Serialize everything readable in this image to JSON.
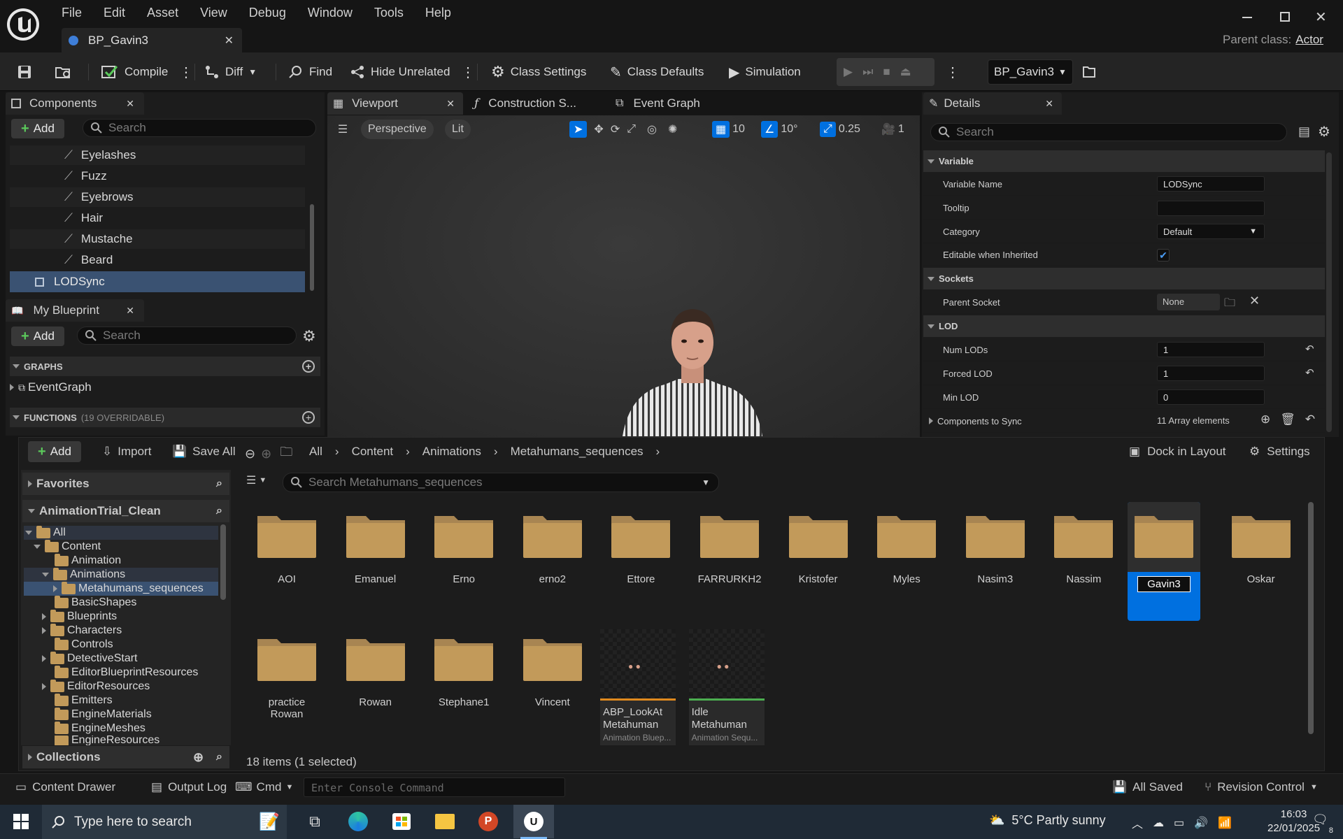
{
  "menu": [
    "File",
    "Edit",
    "Asset",
    "View",
    "Debug",
    "Window",
    "Tools",
    "Help"
  ],
  "doc_tab": {
    "title": "BP_Gavin3"
  },
  "parent_class": {
    "label": "Parent class:",
    "value": "Actor"
  },
  "toolbar": {
    "compile": "Compile",
    "diff": "Diff",
    "find": "Find",
    "hide_unrelated": "Hide Unrelated",
    "class_settings": "Class Settings",
    "class_defaults": "Class Defaults",
    "simulation": "Simulation",
    "debug_object": "BP_Gavin3"
  },
  "components": {
    "tab": "Components",
    "add": "Add",
    "search_placeholder": "Search",
    "items": [
      "Eyelashes",
      "Fuzz",
      "Eyebrows",
      "Hair",
      "Mustache",
      "Beard"
    ],
    "selected": "LODSync"
  },
  "my_blueprint": {
    "tab": "My Blueprint",
    "add": "Add",
    "search_placeholder": "Search",
    "graphs_header": "GRAPHS",
    "event_graph": "EventGraph",
    "functions_header": "FUNCTIONS",
    "functions_count": "(19 OVERRIDABLE)"
  },
  "center_tabs": {
    "viewport": "Viewport",
    "construction": "Construction S...",
    "event_graph": "Event Graph"
  },
  "viewport": {
    "perspective": "Perspective",
    "lit": "Lit",
    "grid": "10",
    "angle": "10°",
    "scale": "0.25",
    "camera": "1"
  },
  "details": {
    "tab": "Details",
    "search_placeholder": "Search",
    "variable_header": "Variable",
    "variable_name_label": "Variable Name",
    "variable_name_value": "LODSync",
    "tooltip_label": "Tooltip",
    "tooltip_value": "",
    "category_label": "Category",
    "category_value": "Default",
    "editable_label": "Editable when Inherited",
    "sockets_header": "Sockets",
    "parent_socket_label": "Parent Socket",
    "parent_socket_value": "None",
    "lod_header": "LOD",
    "num_lods_label": "Num LODs",
    "num_lods_value": "1",
    "forced_lod_label": "Forced LOD",
    "forced_lod_value": "1",
    "min_lod_label": "Min LOD",
    "min_lod_value": "0",
    "components_sync_label": "Components to Sync",
    "components_sync_value": "11 Array elements"
  },
  "content_browser": {
    "add": "Add",
    "import": "Import",
    "save_all": "Save All",
    "breadcrumb": [
      "All",
      "Content",
      "Animations",
      "Metahumans_sequences"
    ],
    "dock": "Dock in Layout",
    "settings": "Settings",
    "favorites": "Favorites",
    "project": "AnimationTrial_Clean",
    "tree": [
      "All",
      "Content",
      "Animation",
      "Animations",
      "Metahumans_sequences",
      "BasicShapes",
      "Blueprints",
      "Characters",
      "Controls",
      "DetectiveStart",
      "EditorBlueprintResources",
      "EditorResources",
      "Emitters",
      "EngineMaterials",
      "EngineMeshes",
      "EngineResources"
    ],
    "collections": "Collections",
    "search_placeholder": "Search Metahumans_sequences",
    "folders_row1": [
      "AOI",
      "Emanuel",
      "Erno",
      "erno2",
      "Ettore",
      "FARRURKH2",
      "Kristofer",
      "Myles",
      "Nasim3",
      "Nassim",
      "Gavin3",
      "Oskar"
    ],
    "folders_row2": [
      "practice Rowan",
      "Rowan",
      "Stephane1",
      "Vincent"
    ],
    "assets": [
      {
        "name": "ABP_LookAt Metahuman",
        "type": "Animation Bluep..."
      },
      {
        "name": "Idle Metahuman",
        "type": "Animation Sequ..."
      }
    ],
    "status": "18 items (1 selected)"
  },
  "bottom_bar": {
    "content_drawer": "Content Drawer",
    "output_log": "Output Log",
    "cmd": "Cmd",
    "console_placeholder": "Enter Console Command",
    "all_saved": "All Saved",
    "revision": "Revision Control"
  },
  "taskbar": {
    "search_placeholder": "Type here to search",
    "weather": "5°C  Partly sunny",
    "time": "16:03",
    "date": "22/01/2025",
    "notifications": "8"
  },
  "colors": {
    "accent": "#0070e0",
    "folder": "#c29a5a",
    "bg": "#151515",
    "panel": "#242424"
  }
}
